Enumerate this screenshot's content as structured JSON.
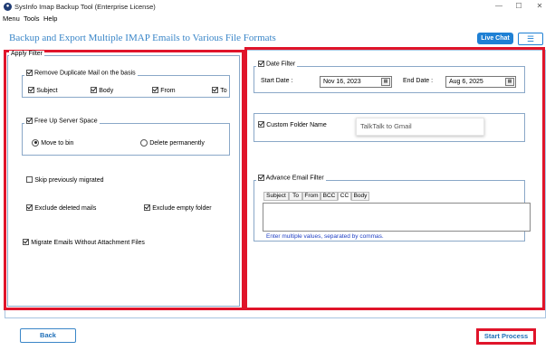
{
  "window": {
    "title": "SysInfo Imap Backup Tool (Enterprise License)",
    "icon": "app-logo-icon",
    "controls": {
      "minimize": "—",
      "maximize": "☐",
      "close": "✕"
    }
  },
  "menu": {
    "items": [
      "Menu",
      "Tools",
      "Help"
    ]
  },
  "header": {
    "title": "Backup and Export Multiple IMAP Emails to Various File Formats",
    "live_chat": "Live Chat",
    "menu_icon": "☰"
  },
  "apply_filter": {
    "legend": "Apply Filter",
    "duplicate": {
      "label": "Remove Duplicate Mail on the basis",
      "checked": true,
      "options": [
        {
          "label": "Subject",
          "checked": true
        },
        {
          "label": "Body",
          "checked": true
        },
        {
          "label": "From",
          "checked": true
        },
        {
          "label": "To",
          "checked": true
        }
      ]
    },
    "free_space": {
      "label": "Free Up Server Space",
      "checked": true,
      "move_to_bin": "Move to bin",
      "delete_permanently": "Delete permanently",
      "selected": "move_to_bin"
    },
    "skip_migrated": {
      "label": "Skip previously migrated",
      "checked": false
    },
    "exclude_deleted": {
      "label": "Exclude deleted mails",
      "checked": true
    },
    "exclude_empty": {
      "label": "Exclude empty folder",
      "checked": true
    },
    "no_attachment": {
      "label": "Migrate Emails Without Attachment Files",
      "checked": true
    }
  },
  "date_filter": {
    "label": "Date Filter",
    "checked": true,
    "start_label": "Start Date :",
    "start_value": "Nov 16, 2023",
    "end_label": "End Date :",
    "end_value": "Aug 6, 2025",
    "calendar_icon": "calendar-icon"
  },
  "custom_folder": {
    "label": "Custom Folder Name",
    "checked": true,
    "value": "TalkTalk to Gmail"
  },
  "advance_filter": {
    "label": "Advance Email Filter",
    "checked": true,
    "tabs": [
      "Subject",
      "To",
      "From",
      "BCC",
      "CC",
      "Body"
    ],
    "active_tab": "CC",
    "hint": "Enter multiple values, separated by commas."
  },
  "footer": {
    "back": "Back",
    "start": "Start Process"
  },
  "colors": {
    "highlight_red": "#e0142a",
    "accent_blue": "#1f80d4",
    "title_blue": "#3a86c8",
    "hint_blue": "#2140c4"
  }
}
